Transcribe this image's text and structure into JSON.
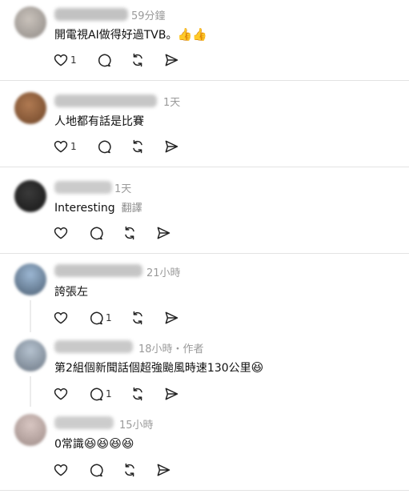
{
  "colors": {
    "background": "#ffffff",
    "text": "#101010",
    "muted": "#9a9a9a",
    "divider": "#e3e3e3"
  },
  "icons": {
    "like": "heart-icon",
    "reply": "comment-icon",
    "repost": "repost-icon",
    "share": "send-icon",
    "emoji_grin": "😆",
    "emoji_thumb": "👍"
  },
  "comments": [
    {
      "author_hidden": true,
      "time": "59分鐘",
      "text": "開電視AI做得好過TVB。",
      "emoji": "👍👍",
      "likes": "1",
      "replies": ""
    },
    {
      "author_hidden": true,
      "time": "1天",
      "text": "人地都有話是比賽",
      "likes": "1",
      "replies": ""
    },
    {
      "author_hidden": true,
      "time": "1天",
      "text": "Interesting",
      "translate": "翻譯",
      "likes": "",
      "replies": ""
    },
    {
      "author_hidden": true,
      "time": "21小時",
      "text": "誇張左",
      "likes": "",
      "replies": "1"
    },
    {
      "author_hidden": true,
      "time": "18小時・作者",
      "text": "第2組個新聞話個超強颱風時速130公里",
      "emoji": "😆",
      "likes": "",
      "replies": "1"
    },
    {
      "author_hidden": true,
      "time": "15小時",
      "text": "0常識",
      "emoji": "😆😆😆😆",
      "likes": "",
      "replies": ""
    }
  ]
}
